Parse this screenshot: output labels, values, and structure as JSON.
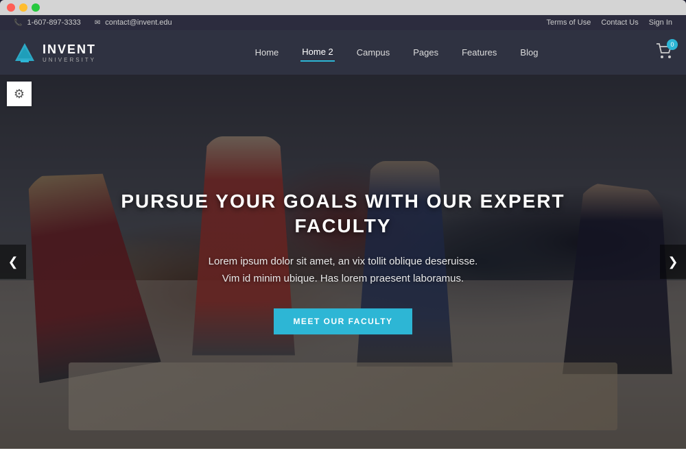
{
  "mac_chrome": {
    "dots": [
      "red",
      "yellow",
      "green"
    ]
  },
  "utility_bar": {
    "phone": "1-607-897-3333",
    "email": "contact@invent.edu",
    "links": [
      {
        "label": "Terms of Use",
        "href": "#"
      },
      {
        "label": "Contact Us",
        "href": "#"
      },
      {
        "label": "Sign In",
        "href": "#"
      }
    ]
  },
  "nav": {
    "logo_name": "INVENT",
    "logo_sub": "UNIVERSITY",
    "links": [
      {
        "label": "Home",
        "active": false
      },
      {
        "label": "Home 2",
        "active": true
      },
      {
        "label": "Campus",
        "active": false
      },
      {
        "label": "Pages",
        "active": false
      },
      {
        "label": "Features",
        "active": false
      },
      {
        "label": "Blog",
        "active": false
      }
    ],
    "cart_count": "0"
  },
  "hero": {
    "title": "PURSUE YOUR GOALS WITH OUR EXPERT FACULTY",
    "subtitle_line1": "Lorem ipsum dolor sit amet, an vix tollit oblique deseruisse.",
    "subtitle_line2": "Vim id minim ubique. Has lorem praesent laboramus.",
    "cta_label": "MEET OUR FACULTY",
    "arrow_left": "❮",
    "arrow_right": "❯"
  },
  "settings": {
    "gear_symbol": "⚙"
  },
  "colors": {
    "accent": "#2db6d5",
    "nav_bg": "#2f3241",
    "utility_bg": "#2c2c3e",
    "overlay": "rgba(15,15,25,0.52)"
  }
}
